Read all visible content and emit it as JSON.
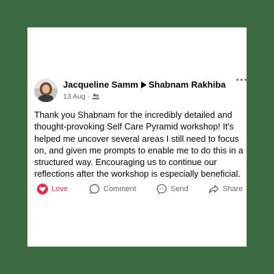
{
  "colors": {
    "frame": "#3c6b42",
    "love": "#f0284a",
    "text": "#050505",
    "muted": "#65676b"
  },
  "post": {
    "author": "Jacqueline Samm",
    "recipient": "Shabnam Rakhiba",
    "date": "13 Aug",
    "audience_icon": "friends-icon",
    "body": "Thank you Shabnam for the incredibly detailed and thought-provoking Self Care Pyramid workshop! It's helped me uncover several areas I still need to focus on, and given me prompts to enable me to do this in a structured way.  Encouraging us to continue our reflections after the workshop is especially beneficial."
  },
  "actions": {
    "love": "Love",
    "comment": "Comment",
    "send": "Send",
    "share": "Share"
  }
}
